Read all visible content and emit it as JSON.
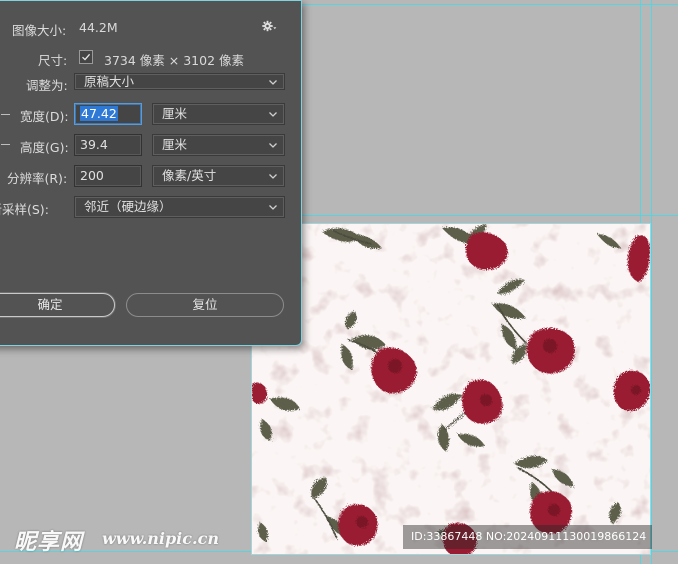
{
  "dialog": {
    "image_size_label": "图像大小:",
    "image_size_value": "44.2M",
    "dimensions_label": "尺寸:",
    "dimensions_value": "3734 像素 × 3102 像素",
    "fit_to_label": "调整为:",
    "fit_to_value": "原稿大小",
    "width_label": "宽度(D):",
    "width_value": "47.42",
    "width_unit": "厘米",
    "height_label": "高度(G):",
    "height_value": "39.4",
    "height_unit": "厘米",
    "resolution_label": "分辨率(R):",
    "resolution_value": "200",
    "resolution_unit": "像素/英寸",
    "resample_label": "重新采样(S):",
    "resample_value": "邻近（硬边缘）",
    "ok_label": "确定",
    "reset_label": "复位",
    "icons": {
      "settings": "gear-icon",
      "checkbox": "check-icon",
      "dropdown": "chevron-down-icon"
    }
  },
  "watermark": {
    "logo_text": "昵享网",
    "site_text": "www.nipic.cn",
    "id_text": "ID:33867448 NO:20240911130019866124"
  },
  "colors": {
    "workspace": "#b7b7b7",
    "dialog_bg": "#535353",
    "guide": "#46d9e6",
    "selection": "#2f79d6",
    "rose": "#9a1a33",
    "leaf": "#5f604d"
  }
}
